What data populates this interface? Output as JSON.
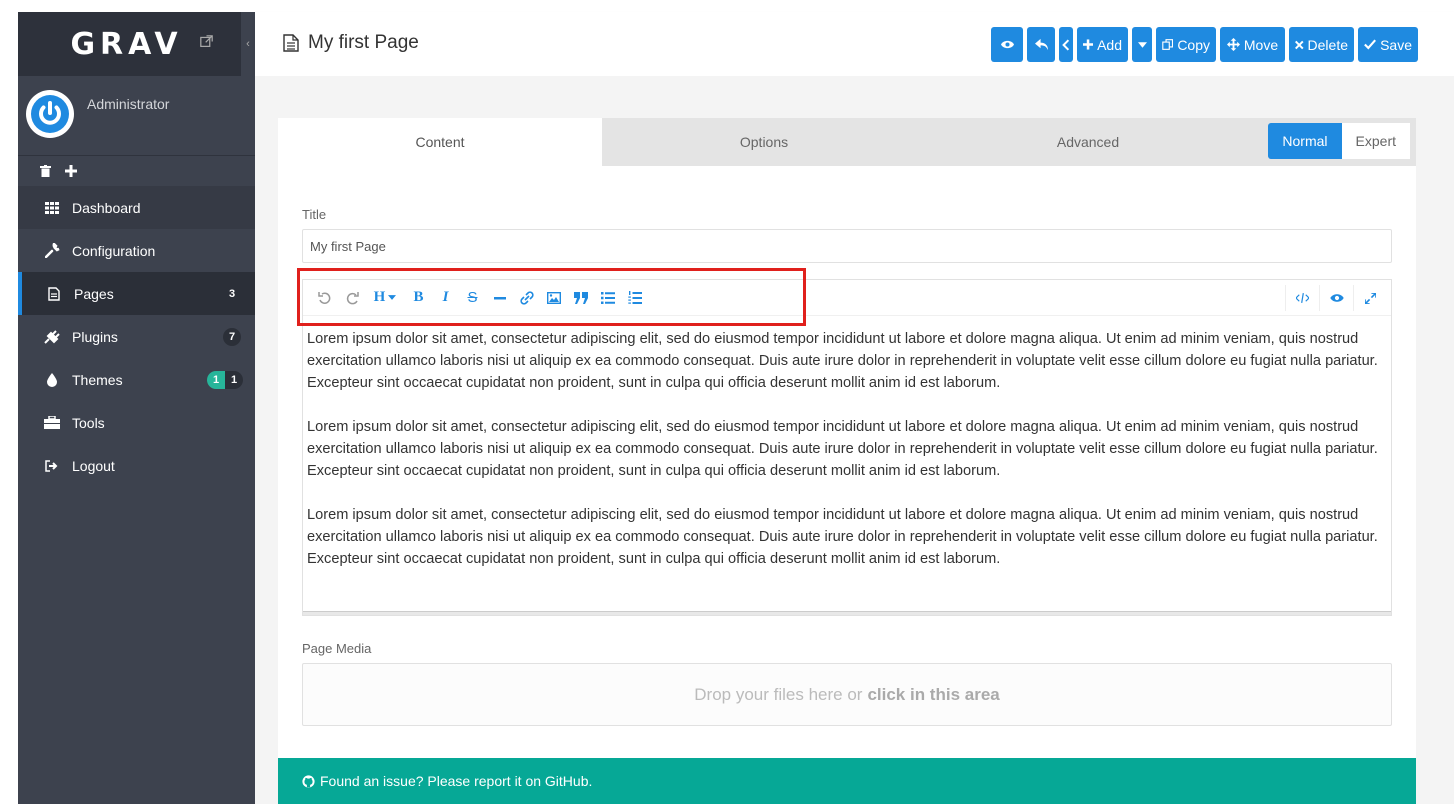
{
  "sidebar": {
    "logo": "GRAV",
    "collapse_glyph": "‹",
    "user_name": "Administrator",
    "quick_actions": [
      "trash-icon",
      "plus-icon"
    ],
    "items": [
      {
        "label": "Dashboard",
        "icon": "grid-icon",
        "badge": ""
      },
      {
        "label": "Configuration",
        "icon": "wrench-icon",
        "badge": ""
      },
      {
        "label": "Pages",
        "icon": "file-icon",
        "badge": "3",
        "active": true
      },
      {
        "label": "Plugins",
        "icon": "plug-icon",
        "badge": "7"
      },
      {
        "label": "Themes",
        "icon": "tint-icon",
        "badge_updates": "1",
        "badge": "1"
      },
      {
        "label": "Tools",
        "icon": "briefcase-icon",
        "badge": ""
      },
      {
        "label": "Logout",
        "icon": "sign-out-icon",
        "badge": ""
      }
    ]
  },
  "header": {
    "title": "My first Page",
    "buttons": {
      "add": "Add",
      "copy": "Copy",
      "move": "Move",
      "delete": "Delete",
      "save": "Save"
    }
  },
  "tabs": [
    "Content",
    "Options",
    "Advanced"
  ],
  "mode": {
    "normal": "Normal",
    "expert": "Expert"
  },
  "form": {
    "title_label": "Title",
    "title_value": "My first Page",
    "editor_paragraphs": [
      "Lorem ipsum dolor sit amet, consectetur adipiscing elit, sed do eiusmod tempor incididunt ut labore et dolore magna aliqua. Ut enim ad minim veniam, quis nostrud exercitation ullamco laboris nisi ut aliquip ex ea commodo consequat. Duis aute irure dolor in reprehenderit in voluptate velit esse cillum dolore eu fugiat nulla pariatur. Excepteur sint occaecat cupidatat non proident, sunt in culpa qui officia deserunt mollit anim id est laborum.",
      "Lorem ipsum dolor sit amet, consectetur adipiscing elit, sed do eiusmod tempor incididunt ut labore et dolore magna aliqua. Ut enim ad minim veniam, quis nostrud exercitation ullamco laboris nisi ut aliquip ex ea commodo consequat. Duis aute irure dolor in reprehenderit in voluptate velit esse cillum dolore eu fugiat nulla pariatur. Excepteur sint occaecat cupidatat non proident, sunt in culpa qui officia deserunt mollit anim id est laborum.",
      "Lorem ipsum dolor sit amet, consectetur adipiscing elit, sed do eiusmod tempor incididunt ut labore et dolore magna aliqua. Ut enim ad minim veniam, quis nostrud exercitation ullamco laboris nisi ut aliquip ex ea commodo consequat. Duis aute irure dolor in reprehenderit in voluptate velit esse cillum dolore eu fugiat nulla pariatur. Excepteur sint occaecat cupidatat non proident, sunt in culpa qui officia deserunt mollit anim id est laborum."
    ],
    "toolbar_heading": "H",
    "toolbar_bold": "B",
    "toolbar_italic": "I",
    "toolbar_strike": "S",
    "media_label": "Page Media",
    "dropzone_text": "Drop your files here or",
    "dropzone_strong": "click in this area"
  },
  "footer": {
    "text": "Found an issue? Please report it on GitHub."
  },
  "colors": {
    "accent": "#1f8ae0",
    "sidebar": "#3d424e",
    "footer": "#06a896",
    "highlight": "#e0201c"
  }
}
